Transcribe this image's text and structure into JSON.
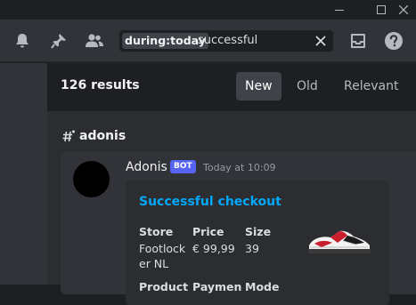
{
  "window_controls": [
    {
      "name": "minimize-button",
      "icon": "minimize-icon"
    },
    {
      "name": "maximize-button",
      "icon": "maximize-icon"
    },
    {
      "name": "close-window-button",
      "icon": "close-icon"
    }
  ],
  "toolbar": {
    "icons": [
      "bell-icon",
      "pin-icon",
      "members-icon",
      "inbox-icon",
      "help-icon"
    ],
    "search": {
      "filter_key": "during:",
      "filter_value": "today",
      "query": "successful"
    }
  },
  "results": {
    "count_label": "126 results",
    "sort_options": [
      {
        "label": "New",
        "active": true
      },
      {
        "label": "Old",
        "active": false
      },
      {
        "label": "Relevant",
        "active": false
      }
    ],
    "channel": "adonis"
  },
  "message": {
    "author": "Adonis",
    "badge": "BOT",
    "timestamp": "Today at 10:09",
    "embed": {
      "title": "Successful checkout",
      "fields": [
        {
          "name": "Store",
          "value_lines": [
            "Footlock",
            "er NL"
          ]
        },
        {
          "name": "Price",
          "value_lines": [
            "€ 99,99"
          ]
        },
        {
          "name": "Size",
          "value_lines": [
            "39"
          ]
        }
      ],
      "next_fields": [
        "Product",
        "Paymen",
        "Mode"
      ]
    }
  },
  "colors": {
    "accent_link": "#00a8fc",
    "bot_badge": "#5865f2",
    "background": "#2b2d31"
  }
}
